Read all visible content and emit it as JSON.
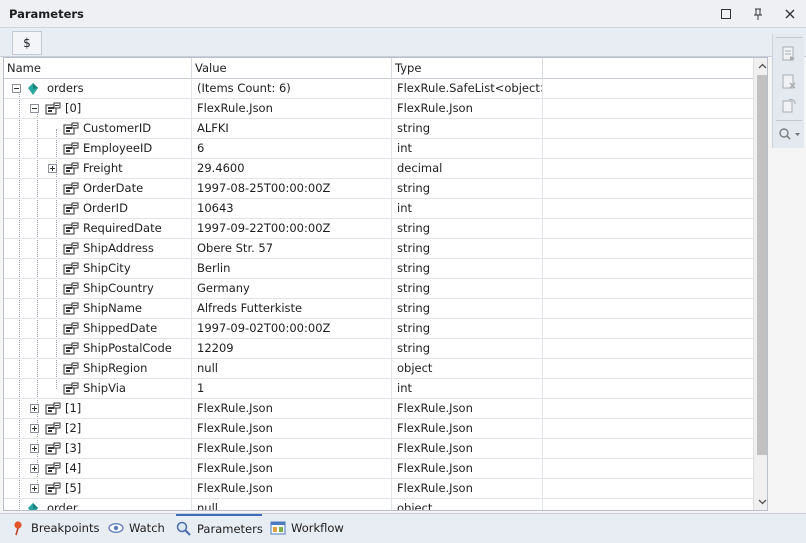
{
  "window": {
    "title": "Parameters",
    "buttons": [
      "maximize-icon",
      "pin-icon",
      "close-icon"
    ]
  },
  "toolbar": {
    "dollar_label": "$"
  },
  "grid": {
    "columns": [
      "Name",
      "Value",
      "Type"
    ],
    "rows": [
      {
        "name": "orders",
        "value": "(Items Count: 6)",
        "type": "FlexRule.SafeList<object>",
        "level": 0,
        "expander": "minus",
        "icon": "diamond-icon"
      },
      {
        "name": "[0]",
        "value": "FlexRule.Json",
        "type": "FlexRule.Json",
        "level": 1,
        "expander": "minus",
        "icon": "object-icon"
      },
      {
        "name": "CustomerID",
        "value": "ALFKI",
        "type": "string",
        "level": 2,
        "expander": "none",
        "icon": "object-icon"
      },
      {
        "name": "EmployeeID",
        "value": "6",
        "type": "int",
        "level": 2,
        "expander": "none",
        "icon": "object-icon"
      },
      {
        "name": "Freight",
        "value": "29.4600",
        "type": "decimal",
        "level": 2,
        "expander": "plus",
        "icon": "object-icon"
      },
      {
        "name": "OrderDate",
        "value": "1997-08-25T00:00:00Z",
        "type": "string",
        "level": 2,
        "expander": "none",
        "icon": "object-icon"
      },
      {
        "name": "OrderID",
        "value": "10643",
        "type": "int",
        "level": 2,
        "expander": "none",
        "icon": "object-icon"
      },
      {
        "name": "RequiredDate",
        "value": "1997-09-22T00:00:00Z",
        "type": "string",
        "level": 2,
        "expander": "none",
        "icon": "object-icon"
      },
      {
        "name": "ShipAddress",
        "value": "Obere Str. 57",
        "type": "string",
        "level": 2,
        "expander": "none",
        "icon": "object-icon"
      },
      {
        "name": "ShipCity",
        "value": "Berlin",
        "type": "string",
        "level": 2,
        "expander": "none",
        "icon": "object-icon"
      },
      {
        "name": "ShipCountry",
        "value": "Germany",
        "type": "string",
        "level": 2,
        "expander": "none",
        "icon": "object-icon"
      },
      {
        "name": "ShipName",
        "value": "Alfreds Futterkiste",
        "type": "string",
        "level": 2,
        "expander": "none",
        "icon": "object-icon"
      },
      {
        "name": "ShippedDate",
        "value": "1997-09-02T00:00:00Z",
        "type": "string",
        "level": 2,
        "expander": "none",
        "icon": "object-icon"
      },
      {
        "name": "ShipPostalCode",
        "value": "12209",
        "type": "string",
        "level": 2,
        "expander": "none",
        "icon": "object-icon"
      },
      {
        "name": "ShipRegion",
        "value": "null",
        "type": "object",
        "level": 2,
        "expander": "none",
        "icon": "object-icon"
      },
      {
        "name": "ShipVia",
        "value": "1",
        "type": "int",
        "level": 2,
        "expander": "none",
        "icon": "object-icon"
      },
      {
        "name": "[1]",
        "value": "FlexRule.Json",
        "type": "FlexRule.Json",
        "level": 1,
        "expander": "plus",
        "icon": "object-icon"
      },
      {
        "name": "[2]",
        "value": "FlexRule.Json",
        "type": "FlexRule.Json",
        "level": 1,
        "expander": "plus",
        "icon": "object-icon"
      },
      {
        "name": "[3]",
        "value": "FlexRule.Json",
        "type": "FlexRule.Json",
        "level": 1,
        "expander": "plus",
        "icon": "object-icon"
      },
      {
        "name": "[4]",
        "value": "FlexRule.Json",
        "type": "FlexRule.Json",
        "level": 1,
        "expander": "plus",
        "icon": "object-icon"
      },
      {
        "name": "[5]",
        "value": "FlexRule.Json",
        "type": "FlexRule.Json",
        "level": 1,
        "expander": "plus",
        "icon": "object-icon"
      },
      {
        "name": "order",
        "value": "null",
        "type": "object",
        "level": 0,
        "expander": "none",
        "icon": "diamond-icon"
      }
    ]
  },
  "side_panel": [
    "add-watch-icon",
    "remove-watch-icon",
    "refresh-watch-icon",
    "search-dropdown-icon"
  ],
  "bottom_tabs": [
    {
      "label": "Breakpoints",
      "icon": "breakpoint-pin-icon"
    },
    {
      "label": "Watch",
      "icon": "eye-icon"
    },
    {
      "label": "Parameters",
      "icon": "magnifier-icon",
      "active": true
    },
    {
      "label": "Workflow",
      "icon": "workflow-icon"
    }
  ],
  "colors": {
    "accent": "#3d6cc0",
    "diamond": "#2aa6a0",
    "background": "#ffffff"
  }
}
